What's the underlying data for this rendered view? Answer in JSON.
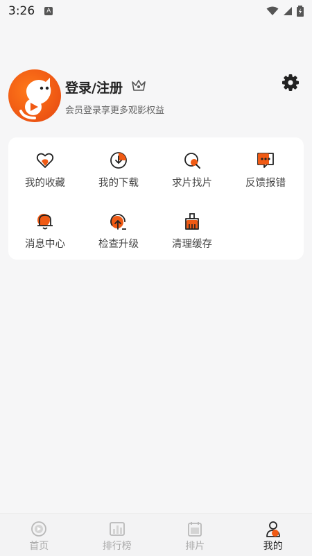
{
  "status_bar": {
    "time": "3:26"
  },
  "profile": {
    "title": "登录/注册",
    "subtitle": "会员登录享更多观影权益",
    "icons": [
      "avatar-cat-play-icon",
      "crown-icon",
      "gear-icon"
    ]
  },
  "menu": {
    "items": [
      {
        "label": "我的收藏",
        "icon": "heart-icon"
      },
      {
        "label": "我的下载",
        "icon": "download-icon"
      },
      {
        "label": "求片找片",
        "icon": "search-film-icon"
      },
      {
        "label": "反馈报错",
        "icon": "feedback-icon"
      },
      {
        "label": "消息中心",
        "icon": "bell-icon"
      },
      {
        "label": "检查升级",
        "icon": "upgrade-icon"
      },
      {
        "label": "清理缓存",
        "icon": "clean-icon"
      }
    ]
  },
  "tabbar": {
    "tabs": [
      {
        "label": "首页",
        "icon": "home-icon"
      },
      {
        "label": "排行榜",
        "icon": "ranking-icon"
      },
      {
        "label": "排片",
        "icon": "schedule-icon"
      },
      {
        "label": "我的",
        "icon": "profile-icon",
        "active": true
      }
    ]
  },
  "colors": {
    "accent": "#f05a14",
    "background": "#f6f6f7",
    "card": "#ffffff"
  }
}
